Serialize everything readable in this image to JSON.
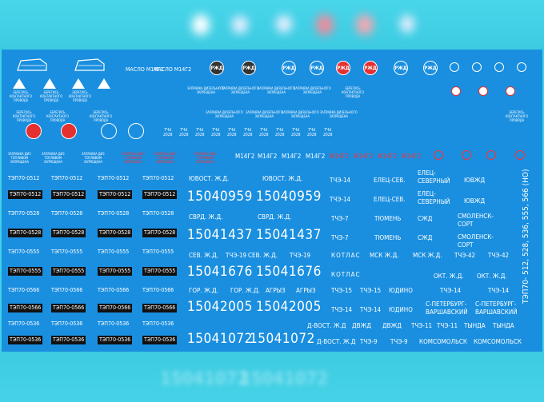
{
  "colors": {
    "sheet": "#1a8fe0",
    "backdrop": "#3fd0e6",
    "accent_red": "#ff3030",
    "plate_bg": "#111111"
  },
  "rows": {
    "plates_col_a": [
      "ТЭП70-0512",
      "ТЭП70-0512",
      "ТЭП70-0528",
      "ТЭП70-0528",
      "ТЭП70-0555",
      "ТЭП70-0555",
      "ТЭП70-0566",
      "ТЭП70-0566",
      "ТЭП70-0536",
      "ТЭП70-0536"
    ],
    "road_1": "ЮВОСТ. Ж.Д.",
    "road_2": "СВРД. Ж.Д.",
    "road_3": "СЕВ. Ж.Д.",
    "road_4": "ТЧЭ-19",
    "road_5": "ГОР. Ж.Д.",
    "road_6": "АГРЫЗ",
    "road_7": "Д-ВОСТ. Ж.Д",
    "road_8": "ДВЖД",
    "num_1": "15040959",
    "num_2": "15041437",
    "num_3": "15041676",
    "num_4": "15042005",
    "num_5": "15041072",
    "depot": {
      "t14": "ТЧЭ-14",
      "t7": "ТЧЭ-7",
      "t15": "ТЧЭ-15",
      "t11": "ТЧЭ-11",
      "t9": "ТЧЭ-9",
      "t42": "ТЧЭ-42",
      "elets": "ЕЛЕЦ-СЕВ.",
      "elets_sev": "ЕЛЕЦ-\nСЕВЕРНЫЙ",
      "uvzh": "ЮВЖД",
      "tyumen": "ТЮМЕНЬ",
      "szhd": "СЖД",
      "smolensk": "СМОЛЕНСК-\nСОРТ",
      "kotlas": "КОТЛАС",
      "msk": "МСК Ж.Д.",
      "okt": "ОКТ. Ж.Д.",
      "yudino": "ЮДИНО",
      "spb": "С-ПЕТЕРБУРГ-\nВАРШАВСКИЙ",
      "tynda": "ТЫНДА",
      "komsomolsk": "КОМСОМОЛЬСК"
    },
    "top_labels": {
      "maslo": "МАСЛО М14Г2",
      "zapr": "ЗАПРАВКА ДИЗЕЛЬНОГО\nЗАПРЕЩЕНА",
      "kontakt": "БЕРЕГИСЬ\nКОНТАКТНОГО\nПРОВОДА",
      "tchd": "ТЧd\n2028",
      "m14g2": "М14Г2",
      "fuel": "ЗАПРАВКА ДИЗ\nТОПЛИВОМ\nЗАПРЕЩЕНА",
      "rzd": "РЖД",
      "vert": "ТЭП70- 512, 528, 536, 555, 566 (НО)"
    }
  }
}
